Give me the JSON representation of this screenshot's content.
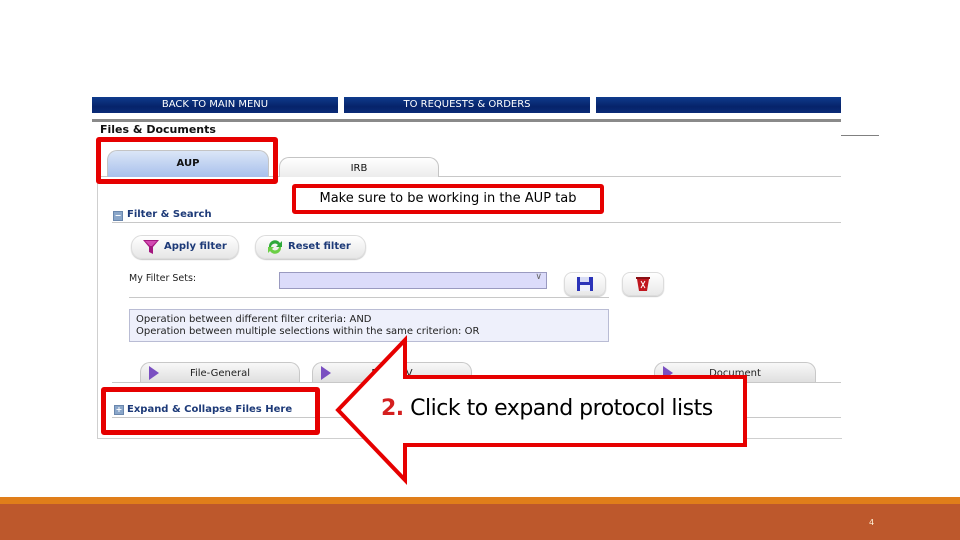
{
  "nav": {
    "back_to_main_menu": "BACK TO MAIN MENU",
    "to_requests_orders": "TO REQUESTS & ORDERS",
    "third_button": ""
  },
  "page_title": "Files & Documents",
  "tabs": [
    {
      "label": "AUP",
      "active": true
    },
    {
      "label": "IRB",
      "active": false
    }
  ],
  "callouts": {
    "tab_note": "Make sure to be working in the AUP tab",
    "step_number": "2.",
    "step_text": " Click to expand protocol lists"
  },
  "filter": {
    "section_label": "Filter & Search",
    "expander_symbol": "−",
    "apply_label": "Apply filter",
    "reset_label": "Reset filter",
    "filter_sets_label": "My Filter Sets:",
    "filter_sets_value": "",
    "info_lines": [
      "Operation between different filter criteria: AND",
      "Operation between multiple selections within the same criterion: OR"
    ],
    "subtabs": [
      "File-General",
      "File-DEV",
      "Document"
    ]
  },
  "files": {
    "expander_symbol": "+",
    "section_label": "Expand & Collapse Files Here"
  },
  "icons": {
    "filter": "funnel-icon",
    "reset": "refresh-icon",
    "save": "floppy-disk-icon",
    "delete": "trash-icon",
    "subtab": "play-triangle-icon"
  },
  "colors": {
    "nav_blue": "#06236a",
    "accent_red": "#e60000",
    "footer": "#bd582c",
    "footer_stripe": "#e07e1a"
  },
  "slide": {
    "page_number": "4"
  }
}
